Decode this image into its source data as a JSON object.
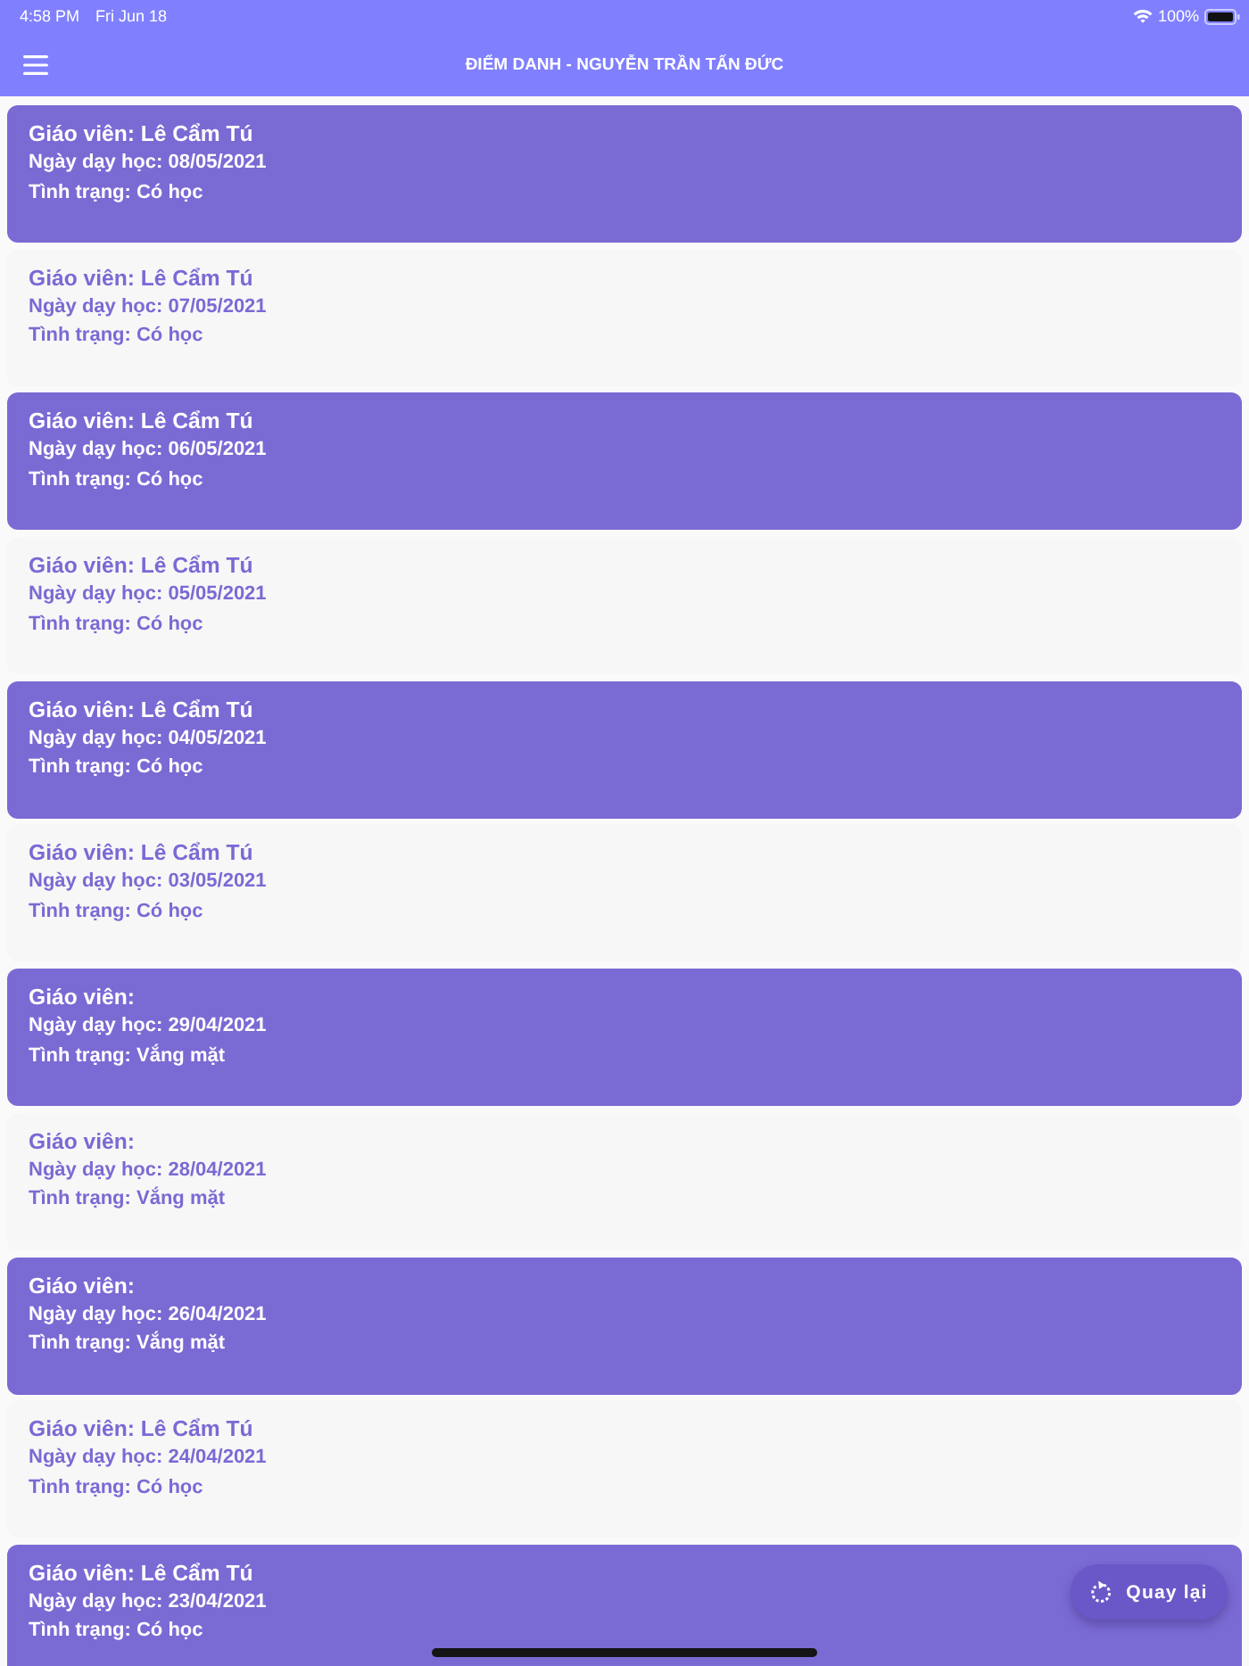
{
  "status_bar": {
    "time": "4:58 PM",
    "date": "Fri Jun 18",
    "battery": "100%"
  },
  "header": {
    "title": "ĐIỂM DANH - NGUYỄN TRẦN TẤN ĐỨC"
  },
  "records": [
    {
      "kind": "filled",
      "teacher": "Giáo viên: Lê Cẩm Tú",
      "date": "Ngày dạy học: 08/05/2021",
      "status": "Tình trạng: Có học"
    },
    {
      "kind": "plain",
      "teacher": "Giáo viên: Lê Cẩm Tú",
      "date": "Ngày dạy học: 07/05/2021",
      "status": "Tình trạng: Có học"
    },
    {
      "kind": "filled",
      "teacher": "Giáo viên: Lê Cẩm Tú",
      "date": "Ngày dạy học: 06/05/2021",
      "status": "Tình trạng: Có học"
    },
    {
      "kind": "plain",
      "teacher": "Giáo viên: Lê Cẩm Tú",
      "date": "Ngày dạy học: 05/05/2021",
      "status": "Tình trạng: Có học"
    },
    {
      "kind": "filled",
      "teacher": "Giáo viên: Lê Cẩm Tú",
      "date": "Ngày dạy học: 04/05/2021",
      "status": "Tình trạng: Có học"
    },
    {
      "kind": "plain",
      "teacher": "Giáo viên: Lê Cẩm Tú",
      "date": "Ngày dạy học: 03/05/2021",
      "status": "Tình trạng: Có học"
    },
    {
      "kind": "filled",
      "teacher": "Giáo viên:",
      "date": "Ngày dạy học: 29/04/2021",
      "status": "Tình trạng: Vắng mặt"
    },
    {
      "kind": "plain",
      "teacher": "Giáo viên:",
      "date": "Ngày dạy học: 28/04/2021",
      "status": "Tình trạng: Vắng mặt"
    },
    {
      "kind": "filled",
      "teacher": "Giáo viên:",
      "date": "Ngày dạy học: 26/04/2021",
      "status": "Tình trạng: Vắng mặt"
    },
    {
      "kind": "plain",
      "teacher": "Giáo viên: Lê Cẩm Tú",
      "date": "Ngày dạy học: 24/04/2021",
      "status": "Tình trạng: Có học"
    },
    {
      "kind": "filled",
      "teacher": "Giáo viên: Lê Cẩm Tú",
      "date": "Ngày dạy học: 23/04/2021",
      "status": "Tình trạng: Có học"
    }
  ],
  "fab": {
    "label": "Quay lại"
  }
}
